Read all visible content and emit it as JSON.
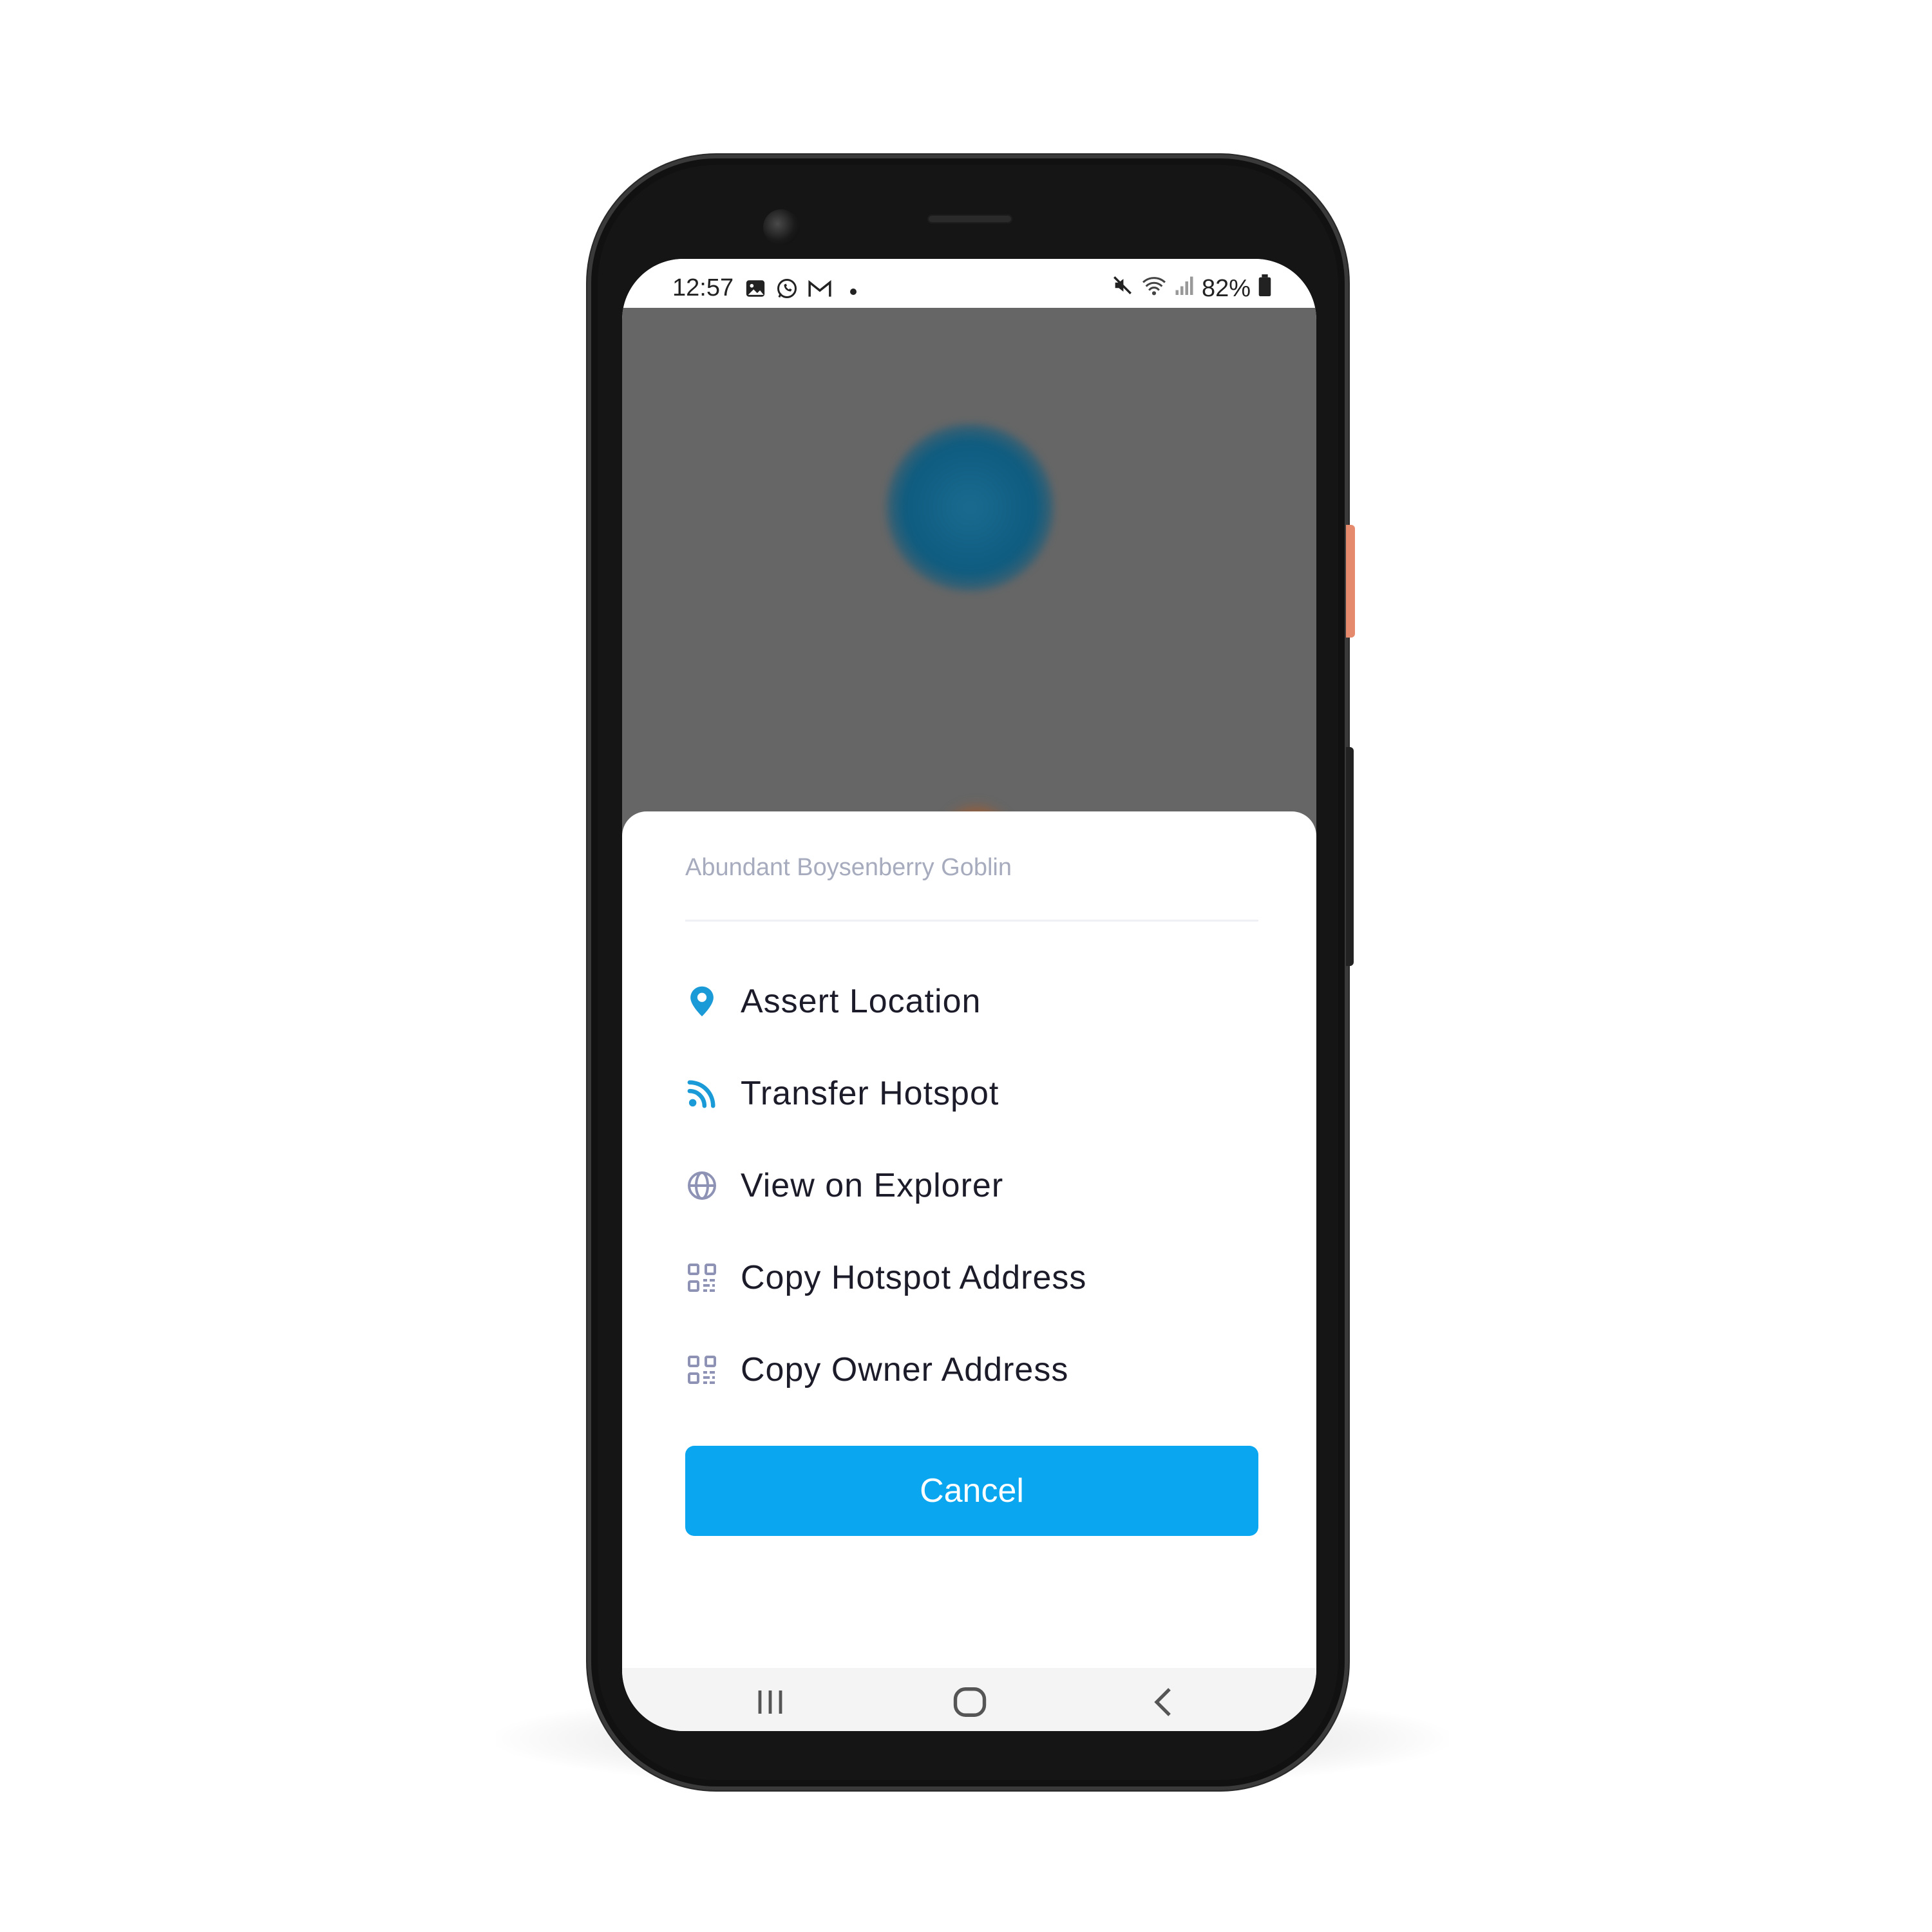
{
  "status_bar": {
    "time": "12:57",
    "battery": "82%",
    "left_icons": [
      "gallery-icon",
      "whatsapp-icon",
      "gmail-icon"
    ],
    "right_icons": [
      "mute-icon",
      "wifi-icon",
      "signal-icon",
      "battery-icon"
    ]
  },
  "sheet": {
    "title": "Abundant Boysenberry Goblin",
    "items": [
      {
        "label": "Assert Location",
        "icon": "location-pin-icon",
        "icon_color": "#1a9ad6"
      },
      {
        "label": "Transfer Hotspot",
        "icon": "rss-icon",
        "icon_color": "#1a9ad6"
      },
      {
        "label": "View on Explorer",
        "icon": "globe-icon",
        "icon_color": "#8e93b5"
      },
      {
        "label": "Copy Hotspot Address",
        "icon": "qr-code-icon",
        "icon_color": "#8e93b5"
      },
      {
        "label": "Copy Owner Address",
        "icon": "qr-code-icon",
        "icon_color": "#8e93b5"
      }
    ],
    "cancel_label": "Cancel"
  },
  "colors": {
    "accent": "#0aa6ef",
    "backdrop": "#666666"
  },
  "nav_bar": {
    "buttons": [
      "recent-apps-icon",
      "home-icon",
      "back-icon"
    ]
  }
}
